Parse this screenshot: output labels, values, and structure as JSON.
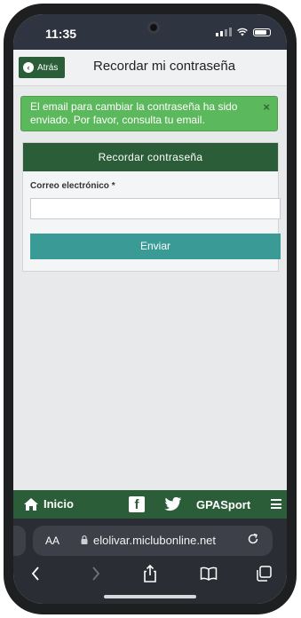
{
  "status": {
    "time": "11:35"
  },
  "header": {
    "back_label": "Atrás",
    "title": "Recordar mi contraseña"
  },
  "alert": {
    "message": "El email para cambiar la contraseña ha sido enviado. Por favor, consulta tu email.",
    "close": "×"
  },
  "form": {
    "heading": "Recordar contraseña",
    "email_label": "Correo electrónico *",
    "email_value": "",
    "submit_label": "Enviar"
  },
  "bottom_nav": {
    "home_label": "Inicio",
    "facebook_glyph": "f",
    "brand_label": "GPASport"
  },
  "browser": {
    "aa_label": "AA",
    "url": "elolivar.miclubonline.net"
  },
  "icons": [
    "home-icon",
    "facebook-icon",
    "twitter-icon",
    "menu-icon",
    "lock-icon",
    "reload-icon",
    "back-icon",
    "forward-icon",
    "share-icon",
    "bookmarks-icon",
    "tabs-icon"
  ],
  "colors": {
    "brand_green": "#2b5d38",
    "alert_green": "#5cb85c",
    "button_teal": "#3a9a96"
  }
}
